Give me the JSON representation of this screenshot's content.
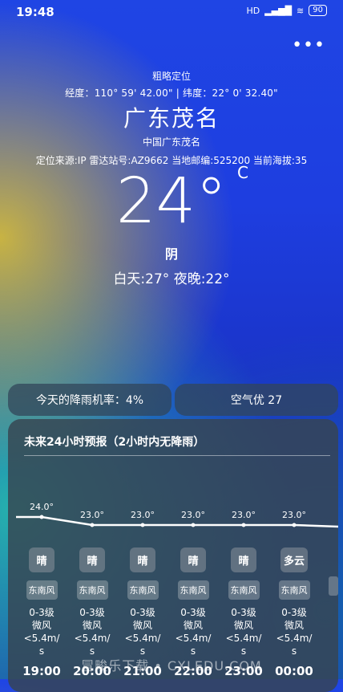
{
  "status_bar": {
    "time": "19:48",
    "network": "HD",
    "battery": "90"
  },
  "header": {
    "more_icon": "more-dots-icon"
  },
  "location": {
    "precision": "粗略定位",
    "coords": "经度：110° 59' 42.00\" | 纬度：22° 0' 32.40\"",
    "city": "广东茂名",
    "full_name": "中国广东茂名",
    "meta": "定位来源:IP  雷达站号:AZ9662  当地邮编:525200  当前海拔:35"
  },
  "current": {
    "temp": "24°",
    "unit": "C",
    "condition": "阴",
    "day_night": "白天:27°  夜晚:22°"
  },
  "summary": {
    "rain_chance": "今天的降雨机率：4%",
    "air_quality": "空气优 27"
  },
  "forecast": {
    "title": "未来24小时预报（2小时内无降雨）",
    "hours": [
      {
        "temp_label": "24.0°",
        "weather": "晴",
        "wind_dir": "东南风",
        "wind_level": "0-3级",
        "wind_desc": "微风",
        "wind_speed": "<5.4m/",
        "wind_unit": "s",
        "time": "19:00"
      },
      {
        "temp_label": "23.0°",
        "weather": "晴",
        "wind_dir": "东南风",
        "wind_level": "0-3级",
        "wind_desc": "微风",
        "wind_speed": "<5.4m/",
        "wind_unit": "s",
        "time": "20:00"
      },
      {
        "temp_label": "23.0°",
        "weather": "晴",
        "wind_dir": "东南风",
        "wind_level": "0-3级",
        "wind_desc": "微风",
        "wind_speed": "<5.4m/",
        "wind_unit": "s",
        "time": "21:00"
      },
      {
        "temp_label": "23.0°",
        "weather": "晴",
        "wind_dir": "东南风",
        "wind_level": "0-3级",
        "wind_desc": "微风",
        "wind_speed": "<5.4m/",
        "wind_unit": "s",
        "time": "22:00"
      },
      {
        "temp_label": "23.0°",
        "weather": "晴",
        "wind_dir": "东南风",
        "wind_level": "0-3级",
        "wind_desc": "微风",
        "wind_speed": "<5.4m/",
        "wind_unit": "s",
        "time": "23:00"
      },
      {
        "temp_label": "23.0°",
        "weather": "多云",
        "wind_dir": "东南风",
        "wind_level": "0-3级",
        "wind_desc": "微风",
        "wind_speed": "<5.4m/",
        "wind_unit": "s",
        "time": "00:00"
      }
    ],
    "temps": [
      24.0,
      23.0,
      23.0,
      23.0,
      23.0,
      23.0
    ]
  },
  "watermark": "冒畯乐下载 • CXLEDU.COM"
}
